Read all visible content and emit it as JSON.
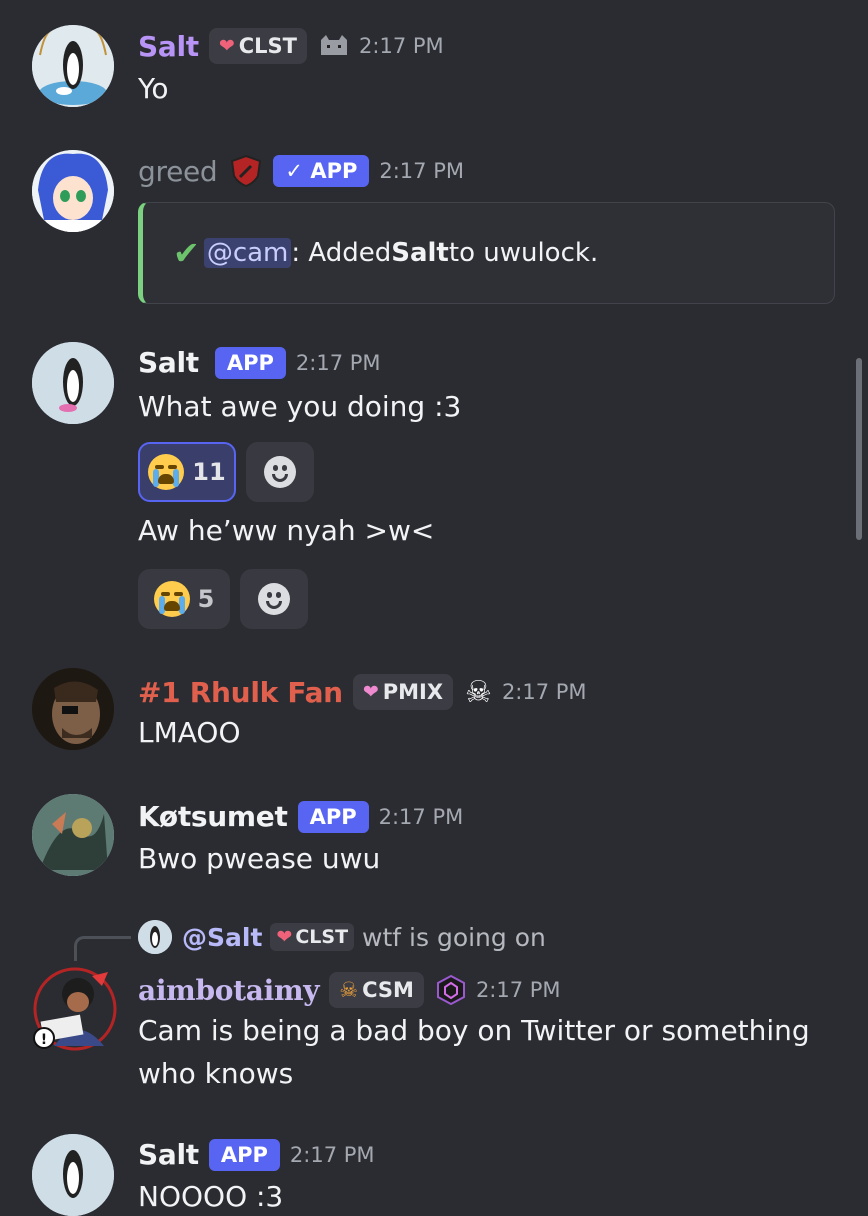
{
  "colors": {
    "background": "#2b2c31",
    "app_badge": "#5865f2",
    "embed_bar": "#7bd17f",
    "rhulk_name": "#e0604d",
    "salt_name": "#b794f6",
    "greed_name": "#8b9299",
    "aimbot_name": "#c7b9f0"
  },
  "messages": [
    {
      "username": "Salt",
      "tag": "CLST",
      "extra_icon": "cat-icon",
      "time": "2:17 PM",
      "text": "Yo"
    },
    {
      "username": "greed",
      "app": "APP",
      "time": "2:17 PM",
      "embed": {
        "mention": "@cam",
        "before_bold": ": Added ",
        "bold": "Salt",
        "after_bold": " to uwulock."
      }
    },
    {
      "username": "Salt",
      "app": "APP",
      "time": "2:17 PM",
      "text": "What awe you doing :3",
      "reaction": {
        "emoji": "sob-emoji",
        "count": "11"
      },
      "text2": "Aw he’ww nyah >w<",
      "reaction2": {
        "emoji": "sob-emoji",
        "count": "5"
      }
    },
    {
      "username": "#1 Rhulk Fan",
      "tag": "PMIX",
      "extra_icon": "skull-crossbones-icon",
      "time": "2:17 PM",
      "text": "LMAOO"
    },
    {
      "username": "Køtsumet",
      "app": "APP",
      "time": "2:17 PM",
      "text": "Bwo pwease uwu"
    },
    {
      "reply": {
        "username": "@Salt",
        "tag": "CLST",
        "text": "wtf is going on"
      },
      "username": "aimbotaimy",
      "tag": "CSM",
      "time": "2:17 PM",
      "text": "Cam is being a bad boy on Twitter or something",
      "text_line2": "who knows"
    },
    {
      "username": "Salt",
      "app": "APP",
      "time": "2:17 PM",
      "text": "NOOOO :3"
    }
  ]
}
